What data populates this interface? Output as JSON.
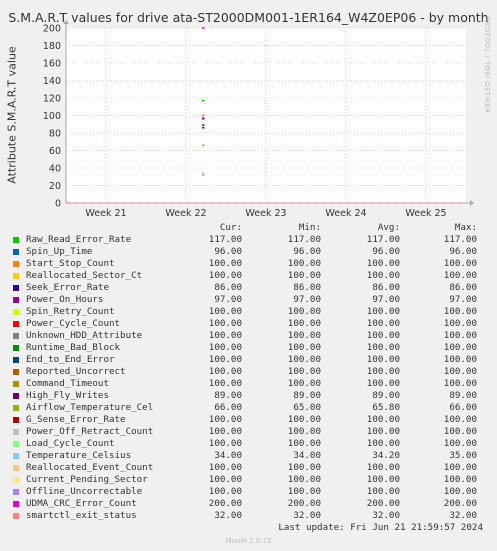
{
  "chart_data": {
    "type": "line",
    "title": "S.M.A.R.T values for drive ata-ST2000DM001-1ER164_W4Z0EP06 - by month",
    "ylabel": "Attribute S.M.A.R.T value",
    "xlabel": "",
    "ylim": [
      0,
      200
    ],
    "yticks": [
      0,
      20,
      40,
      60,
      80,
      100,
      120,
      140,
      160,
      180,
      200
    ],
    "xticks": [
      "Week 21",
      "Week 22",
      "Week 23",
      "Week 24",
      "Week 25"
    ],
    "grid": true,
    "data_start_fraction": 0.34,
    "series": [
      {
        "name": "Raw_Read_Error_Rate",
        "color": "#00cc00",
        "cur": "117.00",
        "min": "117.00",
        "avg": "117.00",
        "max": "117.00",
        "value": 117
      },
      {
        "name": "Spin_Up_Time",
        "color": "#0066b3",
        "cur": "96.00",
        "min": "96.00",
        "avg": "96.00",
        "max": "96.00",
        "value": 96
      },
      {
        "name": "Start_Stop_Count",
        "color": "#ff8000",
        "cur": "100.00",
        "min": "100.00",
        "avg": "100.00",
        "max": "100.00",
        "value": 100
      },
      {
        "name": "Reallocated_Sector_Ct",
        "color": "#ffcc00",
        "cur": "100.00",
        "min": "100.00",
        "avg": "100.00",
        "max": "100.00",
        "value": 100
      },
      {
        "name": "Seek_Error_Rate",
        "color": "#330099",
        "cur": "86.00",
        "min": "86.00",
        "avg": "86.00",
        "max": "86.00",
        "value": 86
      },
      {
        "name": "Power_On_Hours",
        "color": "#990099",
        "cur": "97.00",
        "min": "97.00",
        "avg": "97.00",
        "max": "97.00",
        "value": 97
      },
      {
        "name": "Spin_Retry_Count",
        "color": "#ccff00",
        "cur": "100.00",
        "min": "100.00",
        "avg": "100.00",
        "max": "100.00",
        "value": 100
      },
      {
        "name": "Power_Cycle_Count",
        "color": "#ff0000",
        "cur": "100.00",
        "min": "100.00",
        "avg": "100.00",
        "max": "100.00",
        "value": 100
      },
      {
        "name": "Unknown_HDD_Attribute",
        "color": "#808080",
        "cur": "100.00",
        "min": "100.00",
        "avg": "100.00",
        "max": "100.00",
        "value": 100
      },
      {
        "name": "Runtime_Bad_Block",
        "color": "#008f00",
        "cur": "100.00",
        "min": "100.00",
        "avg": "100.00",
        "max": "100.00",
        "value": 100
      },
      {
        "name": "End_to_End_Error",
        "color": "#00487d",
        "cur": "100.00",
        "min": "100.00",
        "avg": "100.00",
        "max": "100.00",
        "value": 100
      },
      {
        "name": "Reported_Uncorrect",
        "color": "#b35a00",
        "cur": "100.00",
        "min": "100.00",
        "avg": "100.00",
        "max": "100.00",
        "value": 100
      },
      {
        "name": "Command_Timeout",
        "color": "#b38f00",
        "cur": "100.00",
        "min": "100.00",
        "avg": "100.00",
        "max": "100.00",
        "value": 100
      },
      {
        "name": "High_Fly_Writes",
        "color": "#6b006b",
        "cur": "89.00",
        "min": "89.00",
        "avg": "89.00",
        "max": "89.00",
        "value": 89
      },
      {
        "name": "Airflow_Temperature_Cel",
        "color": "#8fb300",
        "cur": "66.00",
        "min": "65.00",
        "avg": "65.80",
        "max": "66.00",
        "value": 66
      },
      {
        "name": "G_Sense_Error_Rate",
        "color": "#b30000",
        "cur": "100.00",
        "min": "100.00",
        "avg": "100.00",
        "max": "100.00",
        "value": 100
      },
      {
        "name": "Power_Off_Retract_Count",
        "color": "#bebebe",
        "cur": "100.00",
        "min": "100.00",
        "avg": "100.00",
        "max": "100.00",
        "value": 100
      },
      {
        "name": "Load_Cycle_Count",
        "color": "#80ff80",
        "cur": "100.00",
        "min": "100.00",
        "avg": "100.00",
        "max": "100.00",
        "value": 100
      },
      {
        "name": "Temperature_Celsius",
        "color": "#80c9ff",
        "cur": "34.00",
        "min": "34.00",
        "avg": "34.20",
        "max": "35.00",
        "value": 34
      },
      {
        "name": "Reallocated_Event_Count",
        "color": "#ffc080",
        "cur": "100.00",
        "min": "100.00",
        "avg": "100.00",
        "max": "100.00",
        "value": 100
      },
      {
        "name": "Current_Pending_Sector",
        "color": "#ffe680",
        "cur": "100.00",
        "min": "100.00",
        "avg": "100.00",
        "max": "100.00",
        "value": 100
      },
      {
        "name": "Offline_Uncorrectable",
        "color": "#aa80ff",
        "cur": "100.00",
        "min": "100.00",
        "avg": "100.00",
        "max": "100.00",
        "value": 100
      },
      {
        "name": "UDMA_CRC_Error_Count",
        "color": "#ee00cc",
        "cur": "200.00",
        "min": "200.00",
        "avg": "200.00",
        "max": "200.00",
        "value": 200
      },
      {
        "name": "smartctl_exit_status",
        "color": "#ff8080",
        "cur": "32.00",
        "min": "32.00",
        "avg": "32.00",
        "max": "32.00",
        "value": 32
      }
    ]
  },
  "legend_headers": {
    "cur": "Cur:",
    "min": "Min:",
    "avg": "Avg:",
    "max": "Max:"
  },
  "last_update": "Last update: Fri Jun 21 21:59:57 2024",
  "side_credit": "RRDTOOL / TOBI OETIKER",
  "footer": "Munin 2.0.73"
}
